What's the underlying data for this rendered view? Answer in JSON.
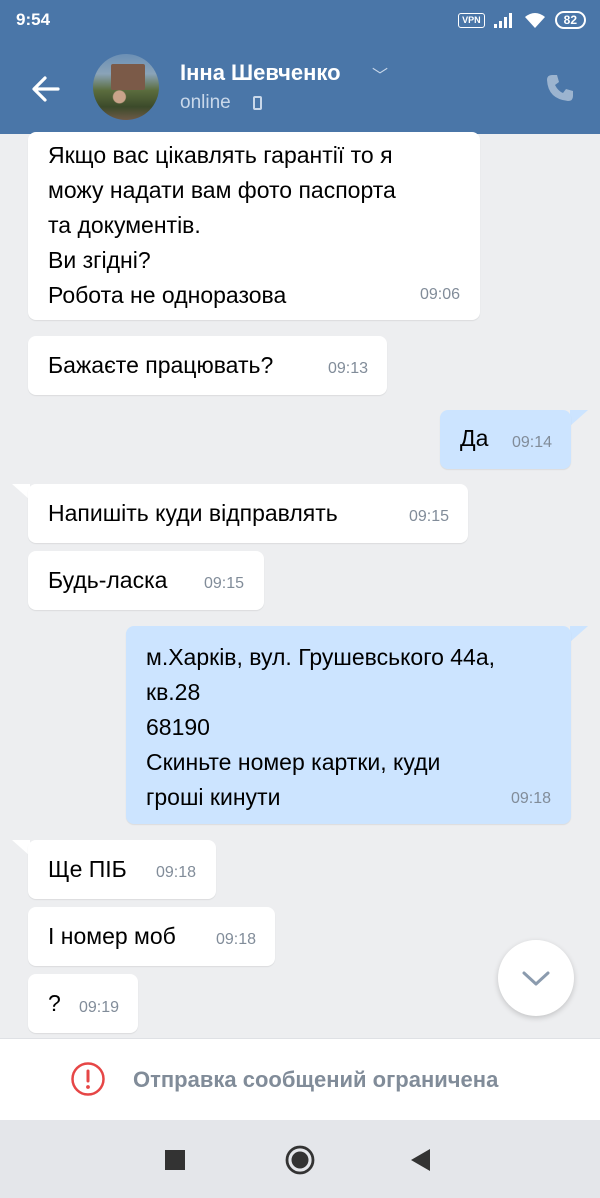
{
  "status_bar": {
    "time": "9:54",
    "vpn_label": "VPN",
    "battery": "82"
  },
  "header": {
    "contact_name": "Інна Шевченко",
    "contact_status": "online"
  },
  "colors": {
    "header_bg": "#4a76a8",
    "incoming_bubble": "#ffffff",
    "outgoing_bubble": "#cce4ff",
    "chat_bg": "#edeef0",
    "restriction_icon": "#e64646"
  },
  "messages": [
    {
      "direction": "in",
      "text": "Якщо вас цікавлять гарантії то я\nможу надати вам фото паспорта\nта документів.\nВи згідні?\nРобота не одноразова",
      "time": "09:06"
    },
    {
      "direction": "in",
      "text": "Бажаєте працювать?",
      "time": "09:13"
    },
    {
      "direction": "out",
      "text": "Да",
      "time": "09:14"
    },
    {
      "direction": "in",
      "text": "Напишіть куди відправлять",
      "time": "09:15"
    },
    {
      "direction": "in",
      "text": "Будь-ласка",
      "time": "09:15"
    },
    {
      "direction": "out",
      "text": "м.Харків, вул. Грушевського 44а,\nкв.28\n68190\nСкиньте номер картки, куди\nгроші кинути",
      "time": "09:18"
    },
    {
      "direction": "in",
      "text": "Ще ПІБ",
      "time": "09:18"
    },
    {
      "direction": "in",
      "text": "І номер моб",
      "time": "09:18"
    },
    {
      "direction": "in",
      "text": "?",
      "time": "09:19"
    }
  ],
  "restriction": {
    "text": "Отправка сообщений ограничена",
    "icon": "exclamation-circle-icon"
  },
  "icons": {
    "back": "arrow-left-icon",
    "call": "phone-icon",
    "scroll": "chevron-down-icon",
    "nav_recents": "square-icon",
    "nav_home": "circle-icon",
    "nav_back": "triangle-back-icon"
  }
}
